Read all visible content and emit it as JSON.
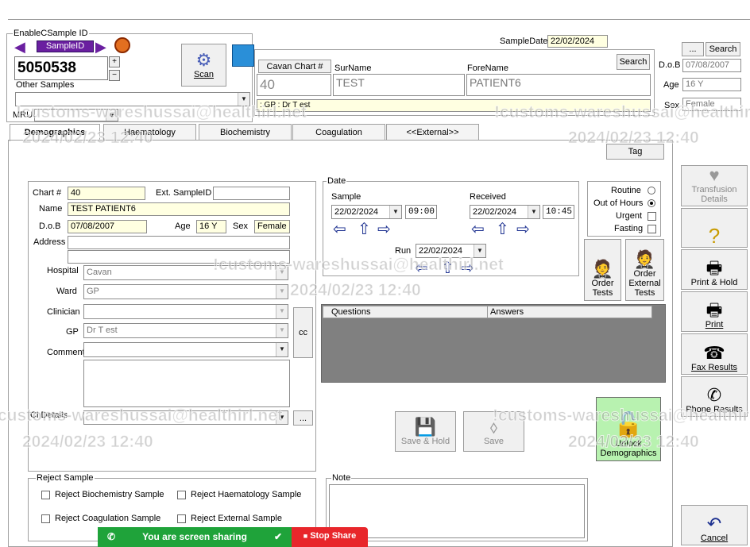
{
  "header": {
    "enable_label": "EnableCSample ID",
    "sampleid_label": "SampleID",
    "sample_id": "5050538",
    "other_samples_label": "Other Samples",
    "mru_label": "MRU",
    "scan_label": "Scan",
    "sampledate_label": "SampleDate",
    "sampledate": "22/02/2024",
    "search_label": "Search",
    "chart_btn": "Cavan Chart #",
    "surname_label": "SurName",
    "forename_label": "ForeName",
    "chart_value": "40",
    "surname": "TEST",
    "forename": "PATIENT6",
    "gp_line": ": GP : Dr T est",
    "dob_label": "D.o.B",
    "dob": "07/08/2007",
    "age_label": "Age",
    "age": "16 Y",
    "sex_label": "Sex",
    "sex": "Female",
    "dots_label": "...",
    "search2_label": "Search"
  },
  "tabs": [
    "Demographics",
    "Haematology",
    "Biochemistry",
    "Coagulation",
    "<<External>>"
  ],
  "tag_label": "Tag",
  "demo": {
    "chart_label": "Chart #",
    "chart": "40",
    "ext_label": "Ext. SampleID",
    "name_label": "Name",
    "name": "TEST PATIENT6",
    "dob_label": "D.o.B",
    "dob": "07/08/2007",
    "age_label": "Age",
    "age": "16 Y",
    "sex_label": "Sex",
    "sex": "Female",
    "address_label": "Address",
    "hospital_label": "Hospital",
    "hospital": "Cavan",
    "ward_label": "Ward",
    "ward": "GP",
    "clinician_label": "Clinician",
    "gp_label": "GP",
    "gp": "Dr T est",
    "comment_label": "Comment",
    "cl_label": "Cl Details",
    "cc_label": "cc",
    "dots": "..."
  },
  "date": {
    "title": "Date",
    "sample_label": "Sample",
    "sample_date": "22/02/2024",
    "sample_time": "09:00",
    "received_label": "Received",
    "received_date": "22/02/2024",
    "received_time": "10:45",
    "run_label": "Run",
    "run_date": "22/02/2024"
  },
  "priority": {
    "routine": "Routine",
    "ooh": "Out of Hours",
    "urgent": "Urgent",
    "fasting": "Fasting"
  },
  "order_tests": "Order Tests",
  "order_external": "Order External Tests",
  "qa": {
    "questions": "Questions",
    "answers": "Answers"
  },
  "actions": {
    "save_hold": "Save & Hold",
    "save": "Save",
    "unlock": "Unlock Demographics"
  },
  "side": {
    "transfusion": "Transfusion Details",
    "print_hold": "Print & Hold",
    "print": "Print",
    "fax": "Fax Results",
    "phone": "Phone Results",
    "cancel": "Cancel"
  },
  "reject": {
    "title": "Reject Sample",
    "bio": "Reject Biochemistry Sample",
    "haem": "Reject Haematology Sample",
    "coag": "Reject Coagulation Sample",
    "ext": "Reject External Sample"
  },
  "note_label": "Note",
  "share": {
    "text": "You are screen sharing",
    "stop": "Stop Share"
  },
  "watermark": {
    "user": "!customs-wareshussai@healthirl.net",
    "ts": "2024/02/23 12:40"
  }
}
